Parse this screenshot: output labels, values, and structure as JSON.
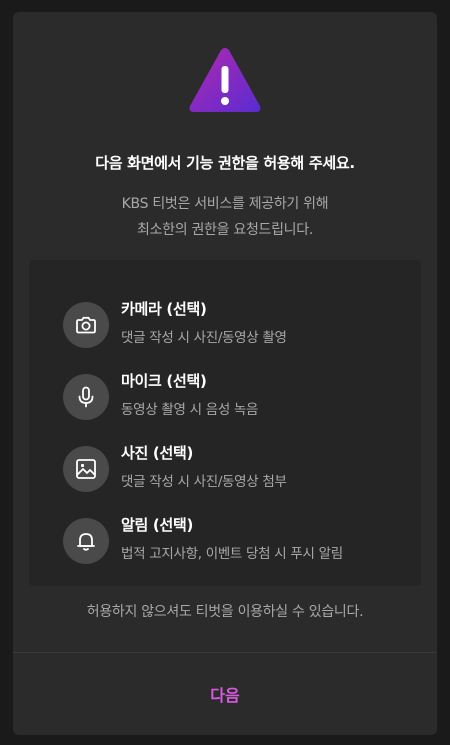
{
  "dialog": {
    "title": "다음 화면에서 기능 권한을 허용해 주세요.",
    "description_line1": "KBS 티벗은 서비스를 제공하기 위해",
    "description_line2": "최소한의 권한을 요청드립니다.",
    "permissions": [
      {
        "title": "카메라 (선택)",
        "description": "댓글 작성 시 사진/동영상 촬영",
        "icon": "camera-icon"
      },
      {
        "title": "마이크 (선택)",
        "description": "동영상 촬영 시 음성 녹음",
        "icon": "microphone-icon"
      },
      {
        "title": "사진 (선택)",
        "description": "댓글 작성 시 사진/동영상 첨부",
        "icon": "photo-icon"
      },
      {
        "title": "알림 (선택)",
        "description": "법적 고지사항, 이벤트 당첨 시 푸시 알림",
        "icon": "bell-icon"
      }
    ],
    "footnote": "허용하지 않으셔도 티벗을 이용하실 수 있습니다.",
    "next_label": "다음"
  },
  "colors": {
    "dialog_background": "#2b2b2b",
    "permission_box_background": "#252525",
    "icon_circle": "#4a4a4a",
    "accent": "#d65be0",
    "warning_gradient_start": "#9b27b0",
    "warning_gradient_end": "#5a2bd1"
  }
}
